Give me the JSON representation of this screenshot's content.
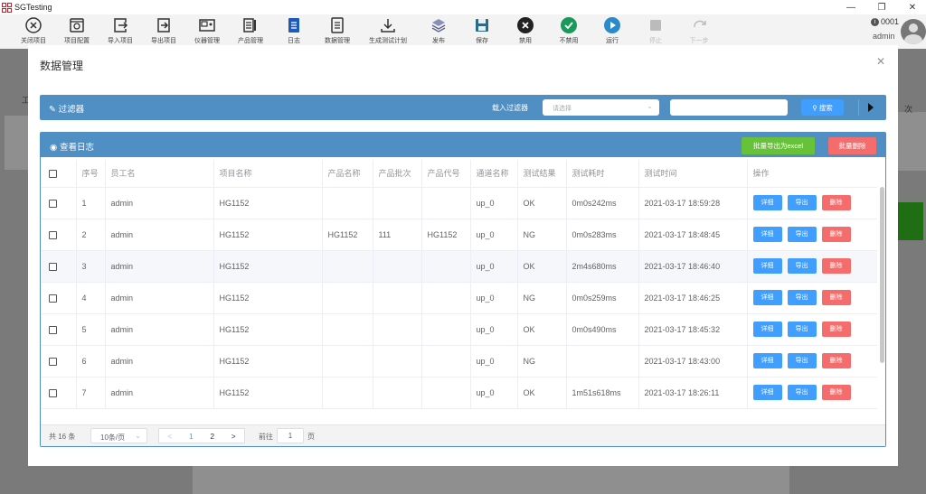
{
  "app": {
    "title": "SGTesting",
    "user_id": "0001",
    "user_name": "admin"
  },
  "toolbar": [
    {
      "label": "关闭项目",
      "icon": "close-circle-icon"
    },
    {
      "label": "项目配置",
      "icon": "config-icon"
    },
    {
      "label": "导入项目",
      "icon": "import-icon"
    },
    {
      "label": "导出项目",
      "icon": "export-icon"
    },
    {
      "label": "仪器管理",
      "icon": "instrument-icon"
    },
    {
      "label": "产品管理",
      "icon": "product-icon"
    },
    {
      "label": "日志",
      "icon": "log-icon"
    },
    {
      "label": "数据管理",
      "icon": "data-icon"
    },
    {
      "label": "生成测试计划",
      "icon": "download-icon"
    },
    {
      "label": "发布",
      "icon": "layers-icon"
    },
    {
      "label": "保存",
      "icon": "save-icon"
    },
    {
      "label": "禁用",
      "icon": "disable-icon"
    },
    {
      "label": "不禁用",
      "icon": "enable-icon"
    },
    {
      "label": "运行",
      "icon": "run-icon"
    },
    {
      "label": "停止",
      "icon": "stop-icon"
    },
    {
      "label": "下一步",
      "icon": "redo-icon"
    }
  ],
  "background": {
    "side_labels": [
      "工",
      "次"
    ]
  },
  "dialog": {
    "title": "数据管理",
    "filter": {
      "title": "过滤器",
      "load_label": "载入过滤器",
      "select_placeholder": "请选择",
      "search_value": "",
      "search_label": "搜索"
    },
    "log": {
      "title": "查看日志",
      "export_label": "批量导出为excel",
      "delete_label": "批量删除"
    },
    "table": {
      "columns": [
        "序号",
        "员工名",
        "项目名称",
        "产品名称",
        "产品批次",
        "产品代号",
        "通道名称",
        "测试结果",
        "测试耗时",
        "测试时间",
        "操作"
      ],
      "actions": [
        "详细",
        "导出",
        "删除"
      ],
      "rows": [
        {
          "no": "1",
          "employee": "admin",
          "project": "HG1152",
          "product": "",
          "batch": "",
          "code": "",
          "channel": "up_0",
          "result": "OK",
          "duration": "0m0s242ms",
          "time": "2021-03-17 18:59:28"
        },
        {
          "no": "2",
          "employee": "admin",
          "project": "HG1152",
          "product": "HG1152",
          "batch": "111",
          "code": "HG1152",
          "channel": "up_0",
          "result": "NG",
          "duration": "0m0s283ms",
          "time": "2021-03-17 18:48:45"
        },
        {
          "no": "3",
          "employee": "admin",
          "project": "HG1152",
          "product": "",
          "batch": "",
          "code": "",
          "channel": "up_0",
          "result": "OK",
          "duration": "2m4s680ms",
          "time": "2021-03-17 18:46:40"
        },
        {
          "no": "4",
          "employee": "admin",
          "project": "HG1152",
          "product": "",
          "batch": "",
          "code": "",
          "channel": "up_0",
          "result": "NG",
          "duration": "0m0s259ms",
          "time": "2021-03-17 18:46:25"
        },
        {
          "no": "5",
          "employee": "admin",
          "project": "HG1152",
          "product": "",
          "batch": "",
          "code": "",
          "channel": "up_0",
          "result": "OK",
          "duration": "0m0s490ms",
          "time": "2021-03-17 18:45:32"
        },
        {
          "no": "6",
          "employee": "admin",
          "project": "HG1152",
          "product": "",
          "batch": "",
          "code": "",
          "channel": "up_0",
          "result": "NG",
          "duration": "",
          "time": "2021-03-17 18:43:00"
        },
        {
          "no": "7",
          "employee": "admin",
          "project": "HG1152",
          "product": "",
          "batch": "",
          "code": "",
          "channel": "up_0",
          "result": "OK",
          "duration": "1m51s618ms",
          "time": "2021-03-17 18:26:11"
        }
      ]
    },
    "pagination": {
      "total": "共 16 条",
      "page_size": "10条/页",
      "prev": "<",
      "pages": [
        "1",
        "2"
      ],
      "next": ">",
      "goto_label": "前往",
      "goto_value": "1",
      "page_suffix": "页"
    }
  },
  "colors": {
    "accent": "#409eff",
    "header": "#4f8fc4",
    "success": "#67c23a",
    "danger": "#f56c6c"
  }
}
